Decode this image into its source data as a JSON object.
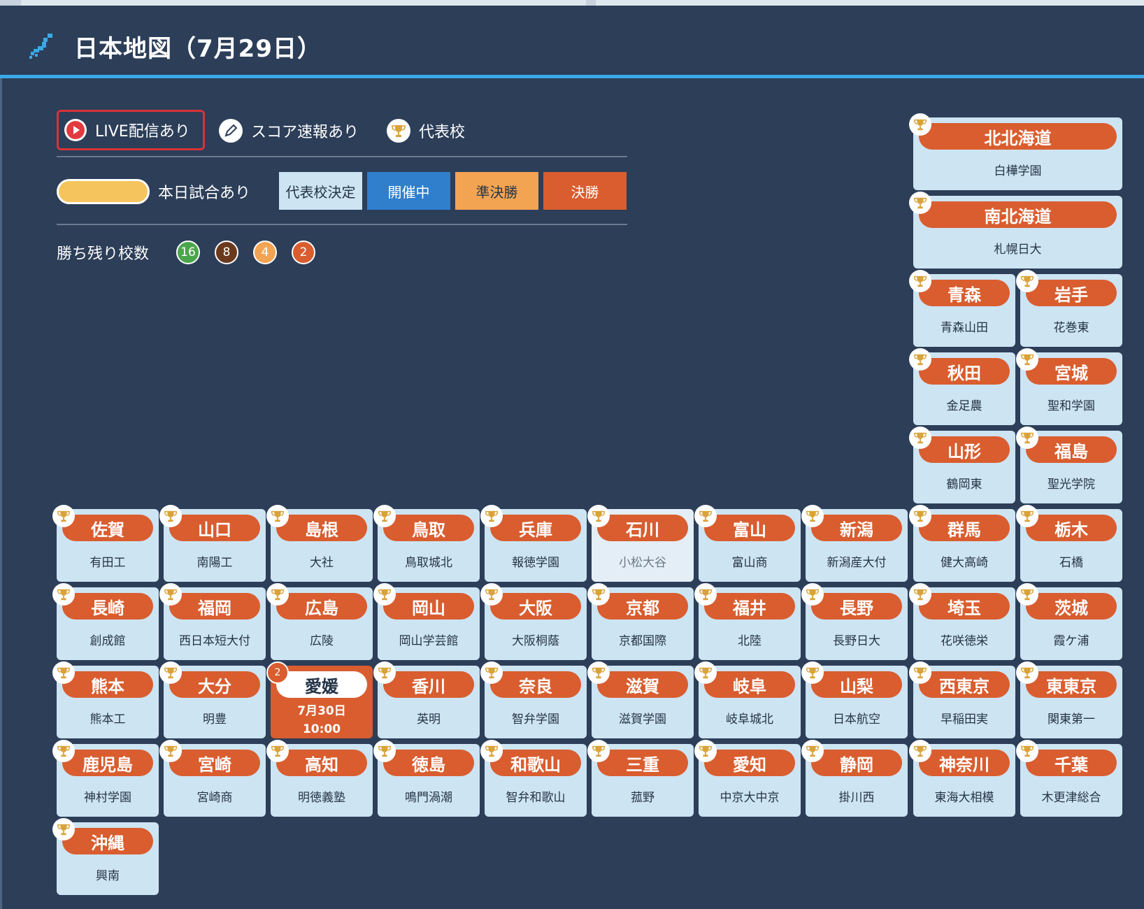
{
  "header": {
    "title": "日本地図（7月29日）"
  },
  "legend": {
    "live": "LIVE配信あり",
    "score": "スコア速報あり",
    "rep": "代表校",
    "today": "本日試合あり",
    "statuses": [
      {
        "label": "代表校決定",
        "bg": "#cde4f3",
        "fg": "#243447"
      },
      {
        "label": "開催中",
        "bg": "#2f7fcd",
        "fg": "#ffffff"
      },
      {
        "label": "準決勝",
        "bg": "#f3a453",
        "fg": "#243447"
      },
      {
        "label": "決勝",
        "bg": "#d95d2f",
        "fg": "#ffffff"
      }
    ],
    "remaining_label": "勝ち残り校数",
    "remaining": [
      {
        "n": "16",
        "color": "#4aa64a"
      },
      {
        "n": "8",
        "color": "#6b3a1e"
      },
      {
        "n": "4",
        "color": "#f3a453"
      },
      {
        "n": "2",
        "color": "#d95d2f"
      }
    ]
  },
  "prefectures": [
    {
      "name": "北北海道",
      "school": "白樺学園"
    },
    {
      "name": "南北海道",
      "school": "札幌日大"
    },
    {
      "name": "青森",
      "school": "青森山田"
    },
    {
      "name": "岩手",
      "school": "花巻東"
    },
    {
      "name": "秋田",
      "school": "金足農"
    },
    {
      "name": "宮城",
      "school": "聖和学園"
    },
    {
      "name": "山形",
      "school": "鶴岡東"
    },
    {
      "name": "福島",
      "school": "聖光学院"
    },
    {
      "name": "佐賀",
      "school": "有田工"
    },
    {
      "name": "山口",
      "school": "南陽工"
    },
    {
      "name": "島根",
      "school": "大社"
    },
    {
      "name": "鳥取",
      "school": "鳥取城北"
    },
    {
      "name": "兵庫",
      "school": "報徳学園"
    },
    {
      "name": "石川",
      "school": "小松大谷"
    },
    {
      "name": "富山",
      "school": "富山商"
    },
    {
      "name": "新潟",
      "school": "新潟産大付"
    },
    {
      "name": "群馬",
      "school": "健大高崎"
    },
    {
      "name": "栃木",
      "school": "石橋"
    },
    {
      "name": "長崎",
      "school": "創成館"
    },
    {
      "name": "福岡",
      "school": "西日本短大付"
    },
    {
      "name": "広島",
      "school": "広陵"
    },
    {
      "name": "岡山",
      "school": "岡山学芸館"
    },
    {
      "name": "大阪",
      "school": "大阪桐蔭"
    },
    {
      "name": "京都",
      "school": "京都国際"
    },
    {
      "name": "福井",
      "school": "北陸"
    },
    {
      "name": "長野",
      "school": "長野日大"
    },
    {
      "name": "埼玉",
      "school": "花咲徳栄"
    },
    {
      "name": "茨城",
      "school": "霞ケ浦"
    },
    {
      "name": "熊本",
      "school": "熊本工"
    },
    {
      "name": "大分",
      "school": "明豊"
    },
    {
      "name": "愛媛",
      "school": "7月30日",
      "remain": "2",
      "time": "10:00"
    },
    {
      "name": "香川",
      "school": "英明"
    },
    {
      "name": "奈良",
      "school": "智弁学園"
    },
    {
      "name": "滋賀",
      "school": "滋賀学園"
    },
    {
      "name": "岐阜",
      "school": "岐阜城北"
    },
    {
      "name": "山梨",
      "school": "日本航空"
    },
    {
      "name": "西東京",
      "school": "早稲田実"
    },
    {
      "name": "東東京",
      "school": "関東第一"
    },
    {
      "name": "鹿児島",
      "school": "神村学園"
    },
    {
      "name": "宮崎",
      "school": "宮崎商"
    },
    {
      "name": "高知",
      "school": "明徳義塾"
    },
    {
      "name": "徳島",
      "school": "鳴門渦潮"
    },
    {
      "name": "和歌山",
      "school": "智弁和歌山"
    },
    {
      "name": "三重",
      "school": "菰野"
    },
    {
      "name": "愛知",
      "school": "中京大中京"
    },
    {
      "name": "静岡",
      "school": "掛川西"
    },
    {
      "name": "神奈川",
      "school": "東海大相模"
    },
    {
      "name": "千葉",
      "school": "木更津総合"
    },
    {
      "name": "沖縄",
      "school": "興南"
    }
  ]
}
